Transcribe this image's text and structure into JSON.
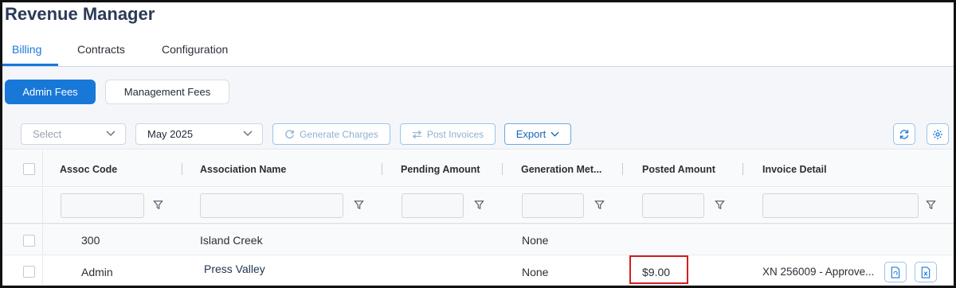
{
  "app": {
    "title": "Revenue Manager"
  },
  "tabs": [
    {
      "label": "Billing",
      "active": true
    },
    {
      "label": "Contracts",
      "active": false
    },
    {
      "label": "Configuration",
      "active": false
    }
  ],
  "fee_tabs": [
    {
      "label": "Admin Fees",
      "active": true
    },
    {
      "label": "Management Fees",
      "active": false
    }
  ],
  "toolbar": {
    "select_placeholder": "Select",
    "period_value": "May 2025",
    "generate_label": "Generate Charges",
    "post_label": "Post Invoices",
    "export_label": "Export",
    "refresh_icon": "refresh-icon",
    "settings_icon": "gear-icon"
  },
  "columns": [
    "Assoc Code",
    "Association Name",
    "Pending Amount",
    "Generation Met...",
    "Posted Amount",
    "Invoice Detail"
  ],
  "rows": [
    {
      "assoc_code": "300",
      "association_name": "Island Creek",
      "pending_amount": "",
      "generation_method": "None",
      "posted_amount": "",
      "invoice_detail": ""
    },
    {
      "assoc_code": "Admin",
      "association_name": "Press Valley",
      "pending_amount": "",
      "generation_method": "None",
      "posted_amount": "$9.00",
      "invoice_detail": "XN 256009 - Approve..."
    }
  ],
  "colors": {
    "accent": "#1878d8",
    "highlight": "#d41d1d",
    "title": "#2c3a57"
  }
}
